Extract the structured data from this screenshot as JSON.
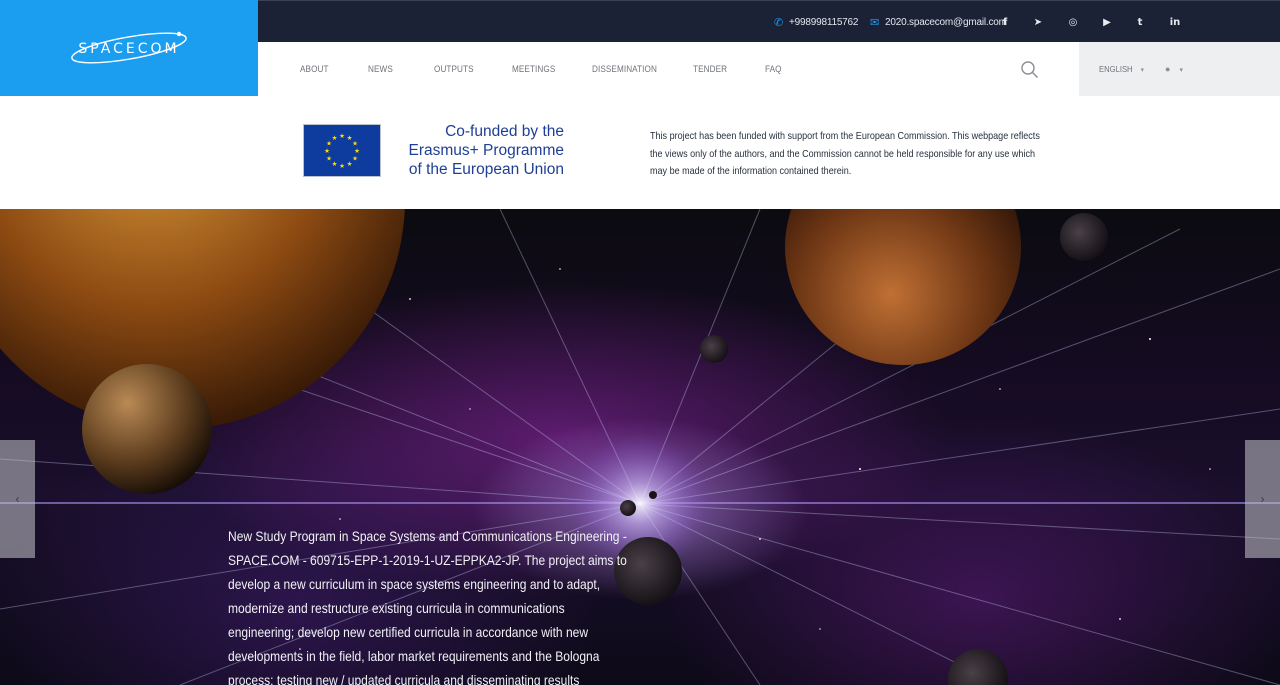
{
  "logo": {
    "text": "SPACECOM",
    "icon": "spacecom-logo"
  },
  "topbar": {
    "phone": "+998998115762",
    "email": "2020.spacecom@gmail.com",
    "phone_icon": "phone-icon",
    "email_icon": "envelope-icon",
    "social": [
      {
        "name": "facebook-icon",
        "glyph": "f"
      },
      {
        "name": "telegram-icon",
        "glyph": "➤"
      },
      {
        "name": "instagram-icon",
        "glyph": "◎"
      },
      {
        "name": "youtube-icon",
        "glyph": "▶"
      },
      {
        "name": "twitter-icon",
        "glyph": "t"
      },
      {
        "name": "linkedin-icon",
        "glyph": "in"
      }
    ]
  },
  "nav": {
    "items": [
      "ABOUT",
      "NEWS",
      "OUTPUTS",
      "MEETINGS",
      "DISSEMINATION",
      "TENDER",
      "FAQ"
    ],
    "language": "ENGLISH",
    "search_icon": "search-icon",
    "user_icon": "user-icon"
  },
  "eu": {
    "cofunded_line1": "Co-funded by the",
    "cofunded_line2": "Erasmus+ Programme",
    "cofunded_line3": "of the European Union",
    "disclaimer": "This project has been funded with support from the European Commission. This webpage reflects the views only of the authors, and the Commission cannot be held responsible for any use which may be made of the information contained therein."
  },
  "hero": {
    "text": "New Study Program in Space Systems and Communications Engineering - SPACE.COM - 609715-EPP-1-2019-1-UZ-EPPKA2-JP. The project aims to develop a new curriculum in space systems engineering and to adapt, modernize and restructure existing curricula in communications engineering; develop new certified curricula in accordance with new developments in the field, labor market requirements and the Bologna process; testing new / updated curricula and disseminating results",
    "prev_glyph": "‹",
    "next_glyph": "›"
  },
  "colors": {
    "brand_blue": "#1b9df0",
    "topbar_bg": "#1b2236",
    "eu_blue": "#1e3f93"
  }
}
